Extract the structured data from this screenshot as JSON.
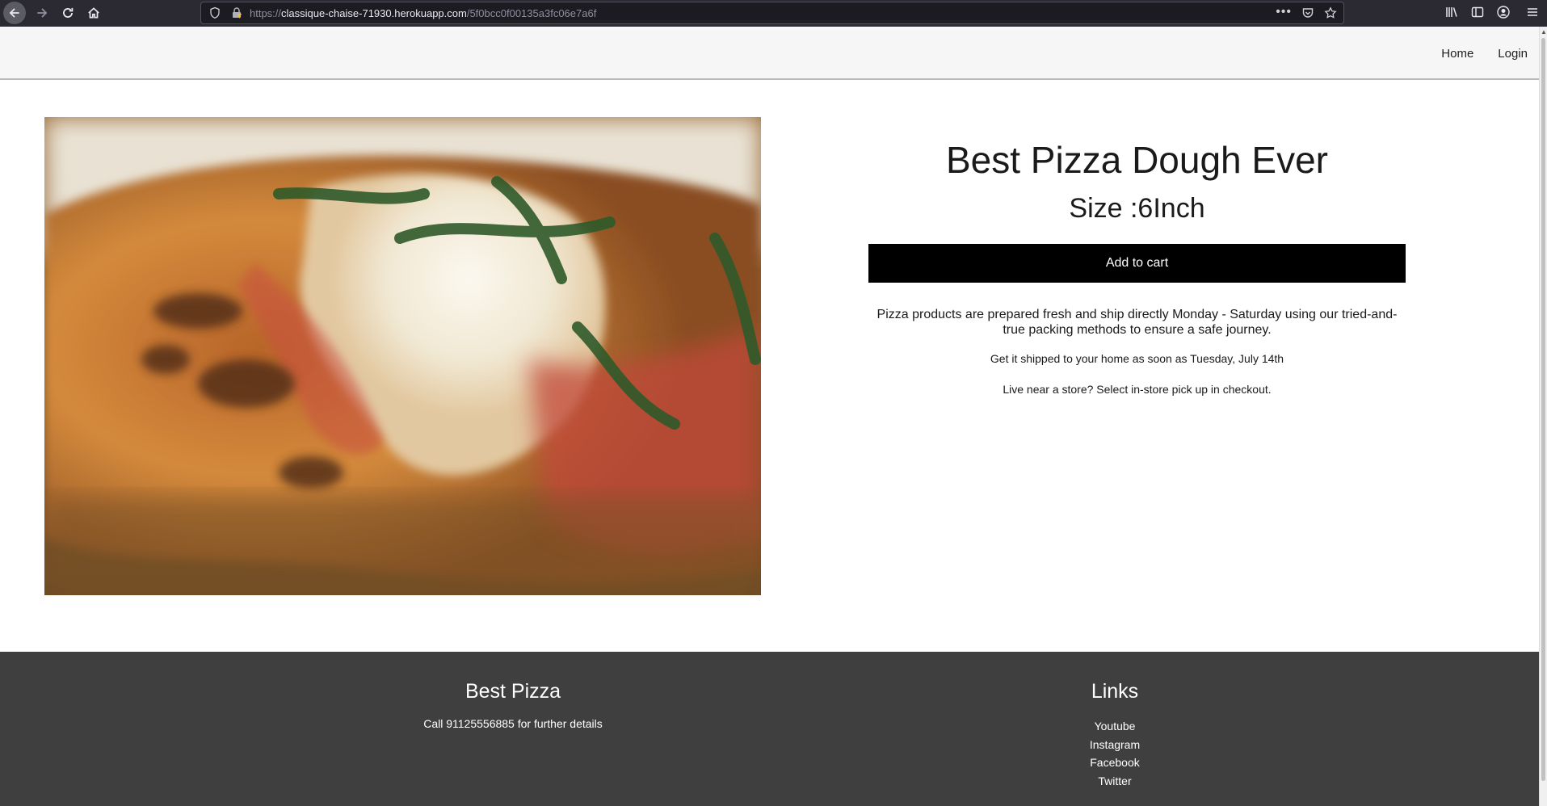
{
  "browser": {
    "url_scheme": "https://",
    "url_host": "classique-chaise-71930.herokuapp.com",
    "url_path": "/5f0bcc0f00135a3fc06e7a6f",
    "page_actions_glyph": "•••"
  },
  "site_nav": {
    "home": "Home",
    "login": "Login"
  },
  "product": {
    "title": "Best Pizza Dough Ever",
    "size": "Size :6Inch",
    "add_to_cart": "Add to cart",
    "description": "Pizza products are prepared fresh and ship directly Monday - Saturday using our tried-and-true packing methods to ensure a safe journey.",
    "shipping": "Get it shipped to your home as soon as Tuesday, July 14th",
    "pickup": "Live near a store? Select in-store pick up in checkout."
  },
  "footer": {
    "brand_heading": "Best Pizza",
    "brand_text": "Call 91125556885 for further details",
    "links_heading": "Links",
    "links": [
      "Youtube",
      "Instagram",
      "Facebook",
      "Twitter"
    ]
  },
  "colors": {
    "footer_bg": "#3f3f3f",
    "button_bg": "#000000",
    "header_bg": "#f6f6f6"
  }
}
